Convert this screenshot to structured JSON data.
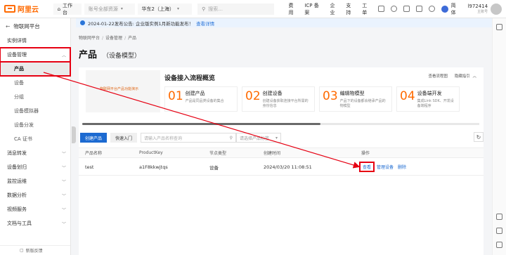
{
  "topbar": {
    "brand": "阿里云",
    "workbench": "工作台",
    "resource_group": "账号全部资源",
    "region": "华东2（上海）",
    "search_placeholder": "搜索...",
    "links": [
      "费用",
      "ICP 备案",
      "企业",
      "支持",
      "工单"
    ],
    "lang": "简体",
    "user_name": "l972414",
    "user_sub": "主账号"
  },
  "sidebar": {
    "title": "物联网平台",
    "items": [
      {
        "label": "实例详情"
      },
      {
        "label": "设备管理"
      },
      {
        "label": "产品"
      },
      {
        "label": "设备"
      },
      {
        "label": "分组"
      },
      {
        "label": "设备模拟器"
      },
      {
        "label": "设备分发"
      },
      {
        "label": "CA 证书"
      },
      {
        "label": "消息转发"
      },
      {
        "label": "设备划归"
      },
      {
        "label": "监控运维"
      },
      {
        "label": "数据分析"
      },
      {
        "label": "视频服务"
      },
      {
        "label": "文档与工具"
      }
    ],
    "footer": "新版反馈"
  },
  "notice": {
    "text": "2024-01-22发布公告: 企业版实例1月新功能发布！",
    "link": "查看详情"
  },
  "breadcrumb": [
    "物联网平台",
    "设备管理",
    "产品"
  ],
  "page": {
    "title": "产品",
    "subtitle": "（设备模型）"
  },
  "flow": {
    "image_caption": "物联网平台产品功能演示",
    "title": "设备接入流程概览",
    "links": [
      "查看流程图",
      "隐藏指引"
    ],
    "steps": [
      {
        "num": "01",
        "title": "创建产品",
        "desc": "产品是同品类设备的集合"
      },
      {
        "num": "02",
        "title": "创建设备",
        "desc": "创建设备获取连接平台所需的身份信息"
      },
      {
        "num": "03",
        "title": "编辑物模型",
        "desc": "产品下的设备都会继承产品的物模型"
      },
      {
        "num": "04",
        "title": "设备端开发",
        "desc": "集成Link SDK、开发设备端程序"
      }
    ],
    "scroll_position": 0.6
  },
  "table": {
    "create_label": "创建产品",
    "quick_label": "快速入门",
    "search_placeholder": "请输入产品名称查询",
    "category_placeholder": "请选择产品标签",
    "headers": [
      "产品名称",
      "ProductKey",
      "节点类型",
      "创建时间",
      "操作"
    ],
    "rows": [
      {
        "name": "test",
        "key": "a1F8kkwjtqs",
        "node": "设备",
        "time": "2024/03/20 11:08:51",
        "ops": [
          "查看",
          "管理设备",
          "删除"
        ]
      }
    ]
  },
  "colors": {
    "brand": "#ff6a00",
    "primary": "#1c6ad1",
    "annotation": "#e60012"
  }
}
